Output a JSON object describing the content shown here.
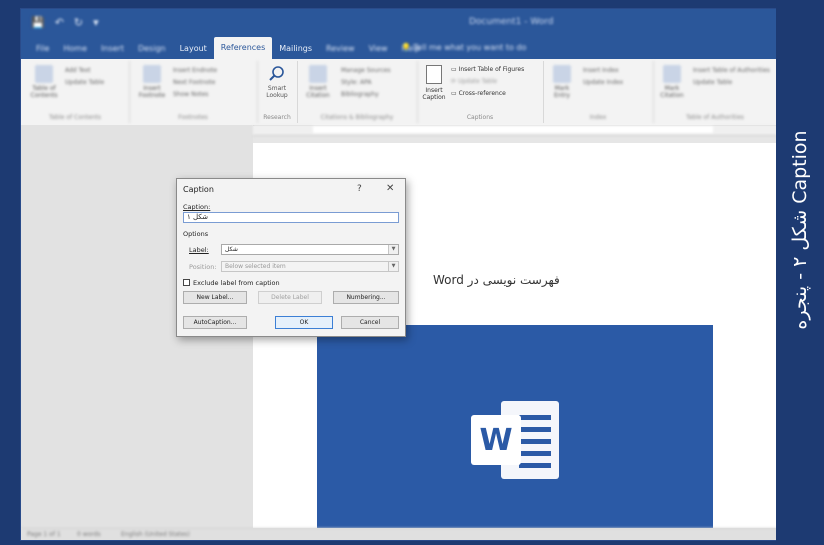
{
  "app": {
    "title": "Document1 - Word",
    "qat": [
      "💾",
      "↶",
      "↻",
      "▾"
    ]
  },
  "tabs": [
    "File",
    "Home",
    "Insert",
    "Design",
    "Layout",
    "References",
    "Mailings",
    "Review",
    "View",
    "Help"
  ],
  "active_tab": "References",
  "tell_me": "Tell me what you want to do",
  "ribbon": {
    "toc": {
      "button": "Table of Contents",
      "add_text": "Add Text",
      "update": "Update Table",
      "title": "Table of Contents"
    },
    "footnotes": {
      "insert_footnote": "Insert Endnote",
      "next_footnote": "Next Footnote",
      "show_notes": "Show Notes",
      "button": "Insert Footnote",
      "title": "Footnotes"
    },
    "research": {
      "button": "Smart Lookup",
      "title": "Research"
    },
    "citations": {
      "button": "Insert Citation",
      "manage": "Manage Sources",
      "style": "Style: APA",
      "bibliography": "Bibliography",
      "title": "Citations & Bibliography"
    },
    "captions": {
      "button_line1": "Insert",
      "button_line2": "Caption",
      "insert_tof": "Insert Table of Figures",
      "update_table": "Update Table",
      "cross_ref": "Cross-reference",
      "title": "Captions"
    },
    "index": {
      "button": "Mark Entry",
      "insert_index": "Insert Index",
      "update_index": "Update Index",
      "title": "Index"
    },
    "authorities": {
      "button": "Mark Citation",
      "insert_toa": "Insert Table of Authorities",
      "update_table": "Update Table",
      "title": "Table of Authorities"
    }
  },
  "document": {
    "heading": "فهرست نویسی در Word"
  },
  "statusbar": {
    "page": "Page 1 of 1",
    "words": "0 words",
    "lang": "English (United States)"
  },
  "dialog": {
    "title": "Caption",
    "help": "?",
    "close": "✕",
    "caption_label": "Caption:",
    "caption_value": "شکل ۱",
    "options_label": "Options",
    "label_label": "Label:",
    "label_value": "شکل",
    "position_label": "Position:",
    "position_value": "Below selected item",
    "exclude_label": "Exclude label from caption",
    "new_label": "New Label...",
    "delete_label": "Delete Label",
    "numbering": "Numbering...",
    "autocaption": "AutoCaption...",
    "ok": "OK",
    "cancel": "Cancel"
  },
  "sidebar_text": "شکل ۲ - پنجره Caption",
  "colors": {
    "word_blue": "#2b579a",
    "frame": "#1d3a72",
    "dialog_bg": "#f3f3f3"
  }
}
